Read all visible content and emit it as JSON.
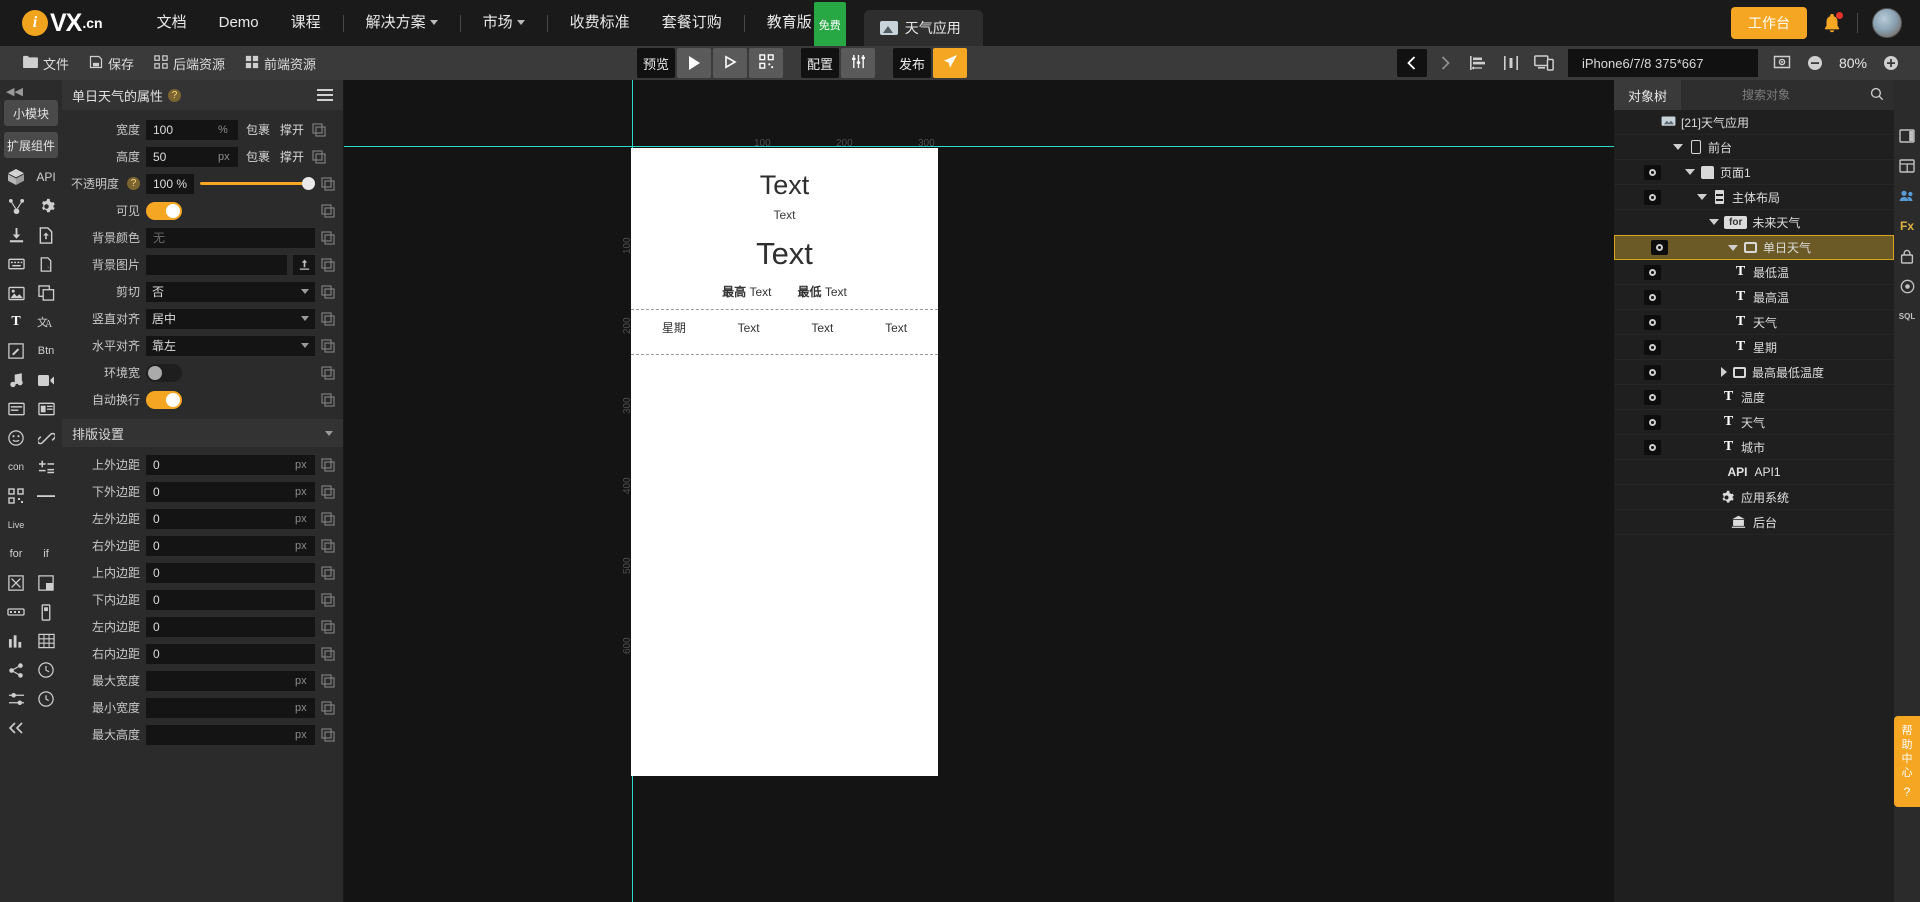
{
  "topnav": {
    "logo": {
      "mark": "i",
      "name": "VX",
      "suffix": ".cn"
    },
    "items": [
      {
        "label": "文档",
        "caret": false
      },
      {
        "label": "Demo",
        "caret": false
      },
      {
        "label": "课程",
        "caret": false
      },
      {
        "label": "解决方案",
        "caret": true
      },
      {
        "label": "市场",
        "caret": true
      },
      {
        "label": "收费标准",
        "caret": false
      },
      {
        "label": "套餐订购",
        "caret": false
      },
      {
        "label": "教育版",
        "caret": false,
        "badge": "免费"
      }
    ],
    "app_tab": "天气应用",
    "workbench_button": "工作台"
  },
  "toolbar": {
    "left": [
      {
        "label": "文件",
        "icon": "folder-icon"
      },
      {
        "label": "保存",
        "icon": "save-icon"
      },
      {
        "label": "后端资源",
        "icon": "backend-resource-icon"
      },
      {
        "label": "前端资源",
        "icon": "frontend-resource-icon"
      }
    ],
    "preview_label": "预览",
    "config_label": "配置",
    "publish_label": "发布",
    "device": "iPhone6/7/8 375*667",
    "zoom": "80%"
  },
  "left_rail": {
    "collapse": "◀◀",
    "tags": [
      "小模块",
      "扩展组件"
    ],
    "icons": [
      "api-icon",
      "api-label",
      "connector-icon",
      "gear-icon",
      "download-icon",
      "file-upload-icon",
      "keyboard-icon",
      "gesture-icon",
      "image-icon",
      "clone-icon",
      "text-icon",
      "translate-icon",
      "edit-icon",
      "button-icon",
      "music-icon",
      "video-icon",
      "list-icon",
      "card-icon",
      "face-icon",
      "link-icon",
      "comment-icon",
      "plusminus-icon",
      "qrcode-icon",
      "line-icon",
      "live-icon",
      "for-icon",
      "if-icon",
      "close-icon",
      "component-icon",
      "slider-icon",
      "progress-icon",
      "chart-icon",
      "table-icon",
      "share-icon",
      "clock-icon",
      "settings-icon",
      "history-icon",
      "collapse-icon"
    ],
    "api_label": "API",
    "for_label": "for",
    "if_label": "if",
    "live_label": "Live",
    "btn_label": "Btn",
    "con_label": "con"
  },
  "props": {
    "title": "单日天气的属性",
    "rows": [
      {
        "label": "宽度",
        "value": "100",
        "unit": "%",
        "opts": [
          "包裹",
          "撑开"
        ]
      },
      {
        "label": "高度",
        "value": "50",
        "unit": "px",
        "opts": [
          "包裹",
          "撑开"
        ]
      },
      {
        "label": "不透明度",
        "value": "100 %",
        "slider": true,
        "help": true
      },
      {
        "label": "可见",
        "toggle": "on"
      },
      {
        "label": "背景颜色",
        "value": "无",
        "placeholder": "无"
      },
      {
        "label": "背景图片",
        "value": "",
        "upload": true
      },
      {
        "label": "剪切",
        "select": "否"
      },
      {
        "label": "竖直对齐",
        "select": "居中"
      },
      {
        "label": "水平对齐",
        "select": "靠左"
      },
      {
        "label": "环境宽",
        "toggle": "off"
      },
      {
        "label": "自动换行",
        "toggle": "on"
      }
    ],
    "section_layout": "排版设置",
    "layout_rows": [
      {
        "label": "上外边距",
        "value": "0",
        "unit": "px"
      },
      {
        "label": "下外边距",
        "value": "0",
        "unit": "px"
      },
      {
        "label": "左外边距",
        "value": "0",
        "unit": "px"
      },
      {
        "label": "右外边距",
        "value": "0",
        "unit": "px"
      },
      {
        "label": "上内边距",
        "value": "0",
        "unit": ""
      },
      {
        "label": "下内边距",
        "value": "0",
        "unit": ""
      },
      {
        "label": "左内边距",
        "value": "0",
        "unit": ""
      },
      {
        "label": "右内边距",
        "value": "0",
        "unit": ""
      },
      {
        "label": "最大宽度",
        "value": "",
        "unit": "px"
      },
      {
        "label": "最小宽度",
        "value": "",
        "unit": "px"
      },
      {
        "label": "最大高度",
        "value": "",
        "unit": "px"
      }
    ]
  },
  "canvas": {
    "ruler_h": [
      "100",
      "200",
      "300"
    ],
    "ruler_v": [
      "100",
      "200",
      "300",
      "400",
      "500",
      "600"
    ],
    "preview": {
      "title": "Text",
      "subtitle": "Text",
      "big": "Text",
      "high_label": "最高",
      "high_value": "Text",
      "low_label": "最低",
      "low_value": "Text",
      "week_label": "星期",
      "week_cells": [
        "Text",
        "Text",
        "Text"
      ]
    }
  },
  "tree": {
    "tab": "对象树",
    "search_placeholder": "搜索对象",
    "nodes": [
      {
        "label": "[21]天气应用",
        "indent": 0,
        "eye": false,
        "arrow": "none",
        "icon": "app-icon"
      },
      {
        "label": "前台",
        "indent": 1,
        "eye": false,
        "arrow": "down",
        "icon": "phone-icon"
      },
      {
        "label": "页面1",
        "indent": 2,
        "eye": true,
        "arrow": "down",
        "icon": "page-icon"
      },
      {
        "label": "主体布局",
        "indent": 3,
        "eye": true,
        "arrow": "down",
        "icon": "layout-icon"
      },
      {
        "label": "未来天气",
        "indent": 4,
        "eye": false,
        "arrow": "down",
        "icon": "for-tag"
      },
      {
        "label": "单日天气",
        "indent": 5,
        "eye": true,
        "arrow": "down",
        "icon": "box-icon",
        "selected": true
      },
      {
        "label": "最低温",
        "indent": 6,
        "eye": true,
        "arrow": "none",
        "icon": "text-icon"
      },
      {
        "label": "最高温",
        "indent": 6,
        "eye": true,
        "arrow": "none",
        "icon": "text-icon"
      },
      {
        "label": "天气",
        "indent": 6,
        "eye": true,
        "arrow": "none",
        "icon": "text-icon"
      },
      {
        "label": "星期",
        "indent": 6,
        "eye": true,
        "arrow": "none",
        "icon": "text-icon"
      },
      {
        "label": "最高最低温度",
        "indent": 5,
        "eye": true,
        "arrow": "right",
        "icon": "box-icon"
      },
      {
        "label": "温度",
        "indent": 5,
        "eye": true,
        "arrow": "none",
        "icon": "text-icon"
      },
      {
        "label": "天气",
        "indent": 5,
        "eye": true,
        "arrow": "none",
        "icon": "text-icon"
      },
      {
        "label": "城市",
        "indent": 5,
        "eye": true,
        "arrow": "none",
        "icon": "text-icon"
      }
    ],
    "flat_nodes": [
      {
        "prefix": "API",
        "label": "API1",
        "icon": "api-icon"
      },
      {
        "prefix": "",
        "label": "应用系统",
        "icon": "gear-icon"
      },
      {
        "prefix": "",
        "label": "后台",
        "icon": "server-icon"
      }
    ]
  },
  "right_rail": {
    "icons": [
      "panel-icon",
      "layers-icon",
      "people-icon",
      "fx-icon",
      "lock-icon",
      "target-icon",
      "sql-icon"
    ],
    "fx_label": "Fx",
    "sql_label": "SQL",
    "help_label": "帮助中心"
  },
  "colors": {
    "accent": "#f5a623",
    "guide": "#32d6c8",
    "selected_row": "#6b5a26",
    "badge_green": "#28a745"
  }
}
